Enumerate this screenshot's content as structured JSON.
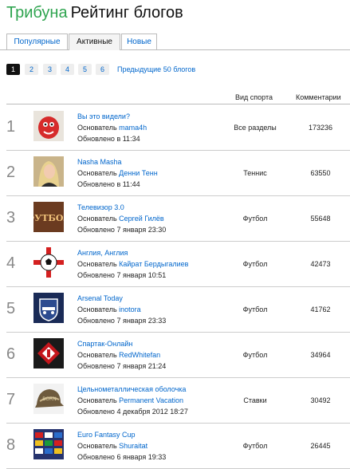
{
  "header": {
    "brand": "Трибуна",
    "title": "Рейтинг блогов"
  },
  "tabs": [
    {
      "label": "Популярные",
      "active": false
    },
    {
      "label": "Активные",
      "active": true
    },
    {
      "label": "Новые",
      "active": false
    }
  ],
  "pager": {
    "pages": [
      "1",
      "2",
      "3",
      "4",
      "5",
      "6"
    ],
    "current": "1",
    "prev_label": "Предыдущие 50 блогов"
  },
  "table": {
    "headers": {
      "sport": "Вид спорта",
      "comments": "Комментарии"
    },
    "founder_label": "Основатель",
    "rows": [
      {
        "rank": "1",
        "title": "Вы это видели?",
        "founder": "mama4h",
        "updated": "Обновлено в 11:34",
        "sport": "Все разделы",
        "comments": "173236",
        "thumb": "red-mascot-icon"
      },
      {
        "rank": "2",
        "title": "Nasha Masha",
        "founder": "Денни Тенн",
        "updated": "Обновлено в 11:44",
        "sport": "Теннис",
        "comments": "63550",
        "thumb": "portrait-icon"
      },
      {
        "rank": "3",
        "title": "Телевизор 3.0",
        "founder": "Сергей Гилёв",
        "updated": "Обновлено 7 января 23:30",
        "sport": "Футбол",
        "comments": "55648",
        "thumb": "futbol-text-icon"
      },
      {
        "rank": "4",
        "title": "Англия, Англия",
        "founder": "Кайрат Бердыгалиев",
        "updated": "Обновлено 7 января 10:51",
        "sport": "Футбол",
        "comments": "42473",
        "thumb": "england-ball-icon"
      },
      {
        "rank": "5",
        "title": "Arsenal Today",
        "founder": "inotora",
        "updated": "Обновлено 7 января 23:33",
        "sport": "Футбол",
        "comments": "41762",
        "thumb": "arsenal-crest-icon"
      },
      {
        "rank": "6",
        "title": "Спартак-Онлайн",
        "founder": "RedWhitefan",
        "updated": "Обновлено 7 января 21:24",
        "sport": "Футбол",
        "comments": "34964",
        "thumb": "spartak-logo-icon"
      },
      {
        "rank": "7",
        "title": "Цельнометаллическая оболочка",
        "founder": "Permanent Vacation",
        "updated": "Обновлено 4 декабря 2012 18:27",
        "sport": "Ставки",
        "comments": "30492",
        "thumb": "helmet-icon"
      },
      {
        "rank": "8",
        "title": "Euro Fantasy Cup",
        "founder": "Shuraitat",
        "updated": "Обновлено 6 января 19:33",
        "sport": "Футбол",
        "comments": "26445",
        "thumb": "flags-icon"
      }
    ]
  },
  "colors": {
    "brand": "#2ea44f",
    "link": "#0066cc",
    "rank": "#888888",
    "active_tab": "#f4f4f4"
  }
}
